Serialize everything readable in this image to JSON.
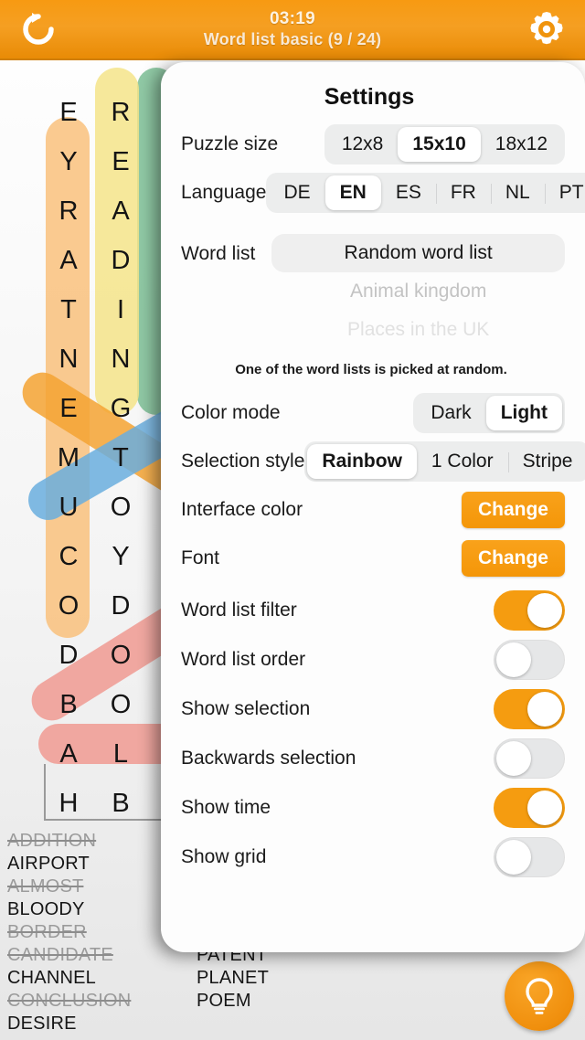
{
  "topbar": {
    "restart_icon": "refresh-icon",
    "time": "03:19",
    "subtitle": "Word list basic (9 / 24)",
    "settings_icon": "gear-icon",
    "bg_color": "#f59f22"
  },
  "puzzle": {
    "grid_letters": [
      [
        "E",
        "R"
      ],
      [
        "Y",
        "E"
      ],
      [
        "R",
        "A"
      ],
      [
        "A",
        "D"
      ],
      [
        "T",
        "I"
      ],
      [
        "N",
        "N"
      ],
      [
        "E",
        "G"
      ],
      [
        "M",
        "T"
      ],
      [
        "U",
        "O"
      ],
      [
        "C",
        "Y"
      ],
      [
        "O",
        "D"
      ],
      [
        "D",
        "O"
      ],
      [
        "B",
        "O"
      ],
      [
        "A",
        "L"
      ],
      [
        "H",
        "B"
      ]
    ],
    "highlight_colors": {
      "orange": "#f9c17c",
      "yellow": "#f5e48a",
      "green": "#7cbf95",
      "blue": "#6aaede",
      "red": "#f09a92",
      "deep_orange": "#f5a333"
    },
    "hint_icon": "lightbulb-icon",
    "hint_color": "#f09208"
  },
  "word_lists": {
    "column_1": [
      {
        "word": "ADDITION",
        "found": true
      },
      {
        "word": "AIRPORT",
        "found": false
      },
      {
        "word": "ALMOST",
        "found": true
      },
      {
        "word": "BLOODY",
        "found": false
      },
      {
        "word": "BORDER",
        "found": true
      },
      {
        "word": "CANDIDATE",
        "found": true
      },
      {
        "word": "CHANNEL",
        "found": false
      },
      {
        "word": "CONCLUSION",
        "found": true
      },
      {
        "word": "DESIRE",
        "found": false
      }
    ],
    "column_2": [
      {
        "word": "PATENT",
        "found": false
      },
      {
        "word": "PLANET",
        "found": false
      },
      {
        "word": "POEM",
        "found": false
      }
    ]
  },
  "settings": {
    "title": "Settings",
    "puzzle_size": {
      "label": "Puzzle size",
      "options": [
        "12x8",
        "15x10",
        "18x12"
      ],
      "selected": "15x10"
    },
    "language": {
      "label": "Language",
      "options": [
        "DE",
        "EN",
        "ES",
        "FR",
        "NL",
        "PT"
      ],
      "selected": "EN"
    },
    "word_list": {
      "label": "Word list",
      "selected": "Random word list",
      "option_1": "Animal kingdom",
      "option_2": "Places in the UK",
      "note": "One of the word lists is picked at random."
    },
    "color_mode": {
      "label": "Color mode",
      "options": [
        "Dark",
        "Light"
      ],
      "selected": "Light"
    },
    "selection_style": {
      "label": "Selection style",
      "options": [
        "Rainbow",
        "1 Color",
        "Stripe"
      ],
      "selected": "Rainbow"
    },
    "interface_color": {
      "label": "Interface color",
      "button": "Change"
    },
    "font": {
      "label": "Font",
      "button": "Change"
    },
    "toggles": [
      {
        "label": "Word list filter",
        "on": true
      },
      {
        "label": "Word list order",
        "on": false
      },
      {
        "label": "Show selection",
        "on": true
      },
      {
        "label": "Backwards selection",
        "on": false
      },
      {
        "label": "Show time",
        "on": true
      },
      {
        "label": "Show grid",
        "on": false
      }
    ],
    "accent_color": "#f59c10"
  }
}
